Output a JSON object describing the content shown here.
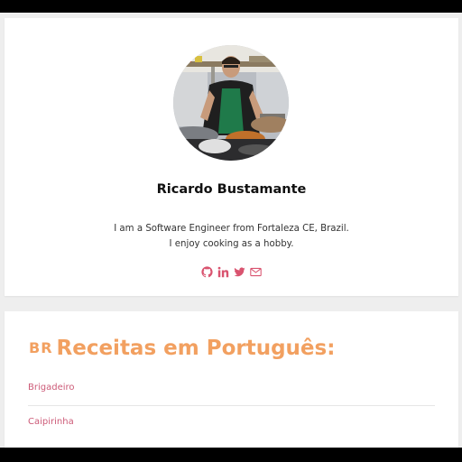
{
  "profile": {
    "name": "Ricardo Bustamante",
    "bio_line1": "I am a Software Engineer from Fortaleza CE, Brazil.",
    "bio_line2": "I enjoy cooking as a hobby.",
    "social_icons": [
      "github-icon",
      "linkedin-icon",
      "twitter-icon",
      "email-icon"
    ],
    "icon_color": "#d9536f"
  },
  "recipes": {
    "flag": "BR",
    "title": "Receitas em Português:",
    "title_color": "#f2a060",
    "items": [
      "Brigadeiro",
      "Caipirinha"
    ],
    "link_color": "#cc5a77"
  }
}
